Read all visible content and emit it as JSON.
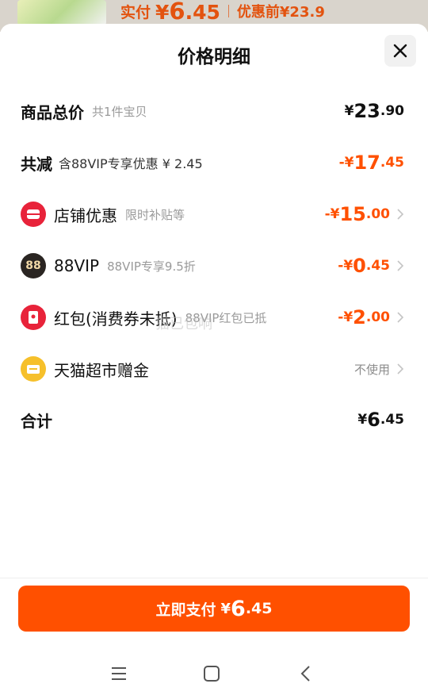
{
  "backdrop": {
    "paid_label": "实付",
    "paid_currency": "¥",
    "paid_int": "6",
    "paid_dec": ".45",
    "orig_label": "优惠前",
    "orig_price": "¥23.9"
  },
  "sheet": {
    "title": "价格明细"
  },
  "rows": {
    "total": {
      "label": "商品总价",
      "sub": "共1件宝贝",
      "currency": "¥",
      "int": "23",
      "dec": ".90"
    },
    "discount": {
      "label": "共减",
      "sub": "含88VIP专享优惠 ¥ 2.45",
      "currency": "-¥",
      "int": "17",
      "dec": ".45"
    },
    "shop": {
      "label": "店铺优惠",
      "sub": "限时补贴等",
      "currency": "-¥",
      "int": "15",
      "dec": ".00"
    },
    "vip": {
      "icon_text": "88",
      "label": "88VIP",
      "sub": "88VIP专享9.5折",
      "currency": "-¥",
      "int": "0",
      "dec": ".45"
    },
    "redpack": {
      "label": "红包(消费券未抵)",
      "sub": "88VIP红包已抵",
      "currency": "-¥",
      "int": "2",
      "dec": ".00"
    },
    "tmall": {
      "label": "天猫超市赠金",
      "right": "不使用"
    },
    "sum": {
      "label": "合计",
      "currency": "¥",
      "int": "6",
      "dec": ".45"
    }
  },
  "watermark": "猫已包响",
  "pay_button": {
    "label": "立即支付",
    "currency": "¥",
    "int": "6",
    "dec": ".45"
  },
  "icons": {
    "close": "close-icon",
    "shop": "shop-icon",
    "vip": "88vip-icon",
    "redpack": "red-packet-icon",
    "tmall": "tmall-icon",
    "chevron": "chevron-right-icon",
    "menu": "menu-icon",
    "home": "home-icon",
    "back": "back-icon"
  },
  "colors": {
    "accent": "#ff5000",
    "shop_icon": "#e8233a",
    "vip_icon": "#2a2522",
    "redpack_icon": "#e8233a",
    "tmall_icon": "#f6c02b"
  }
}
